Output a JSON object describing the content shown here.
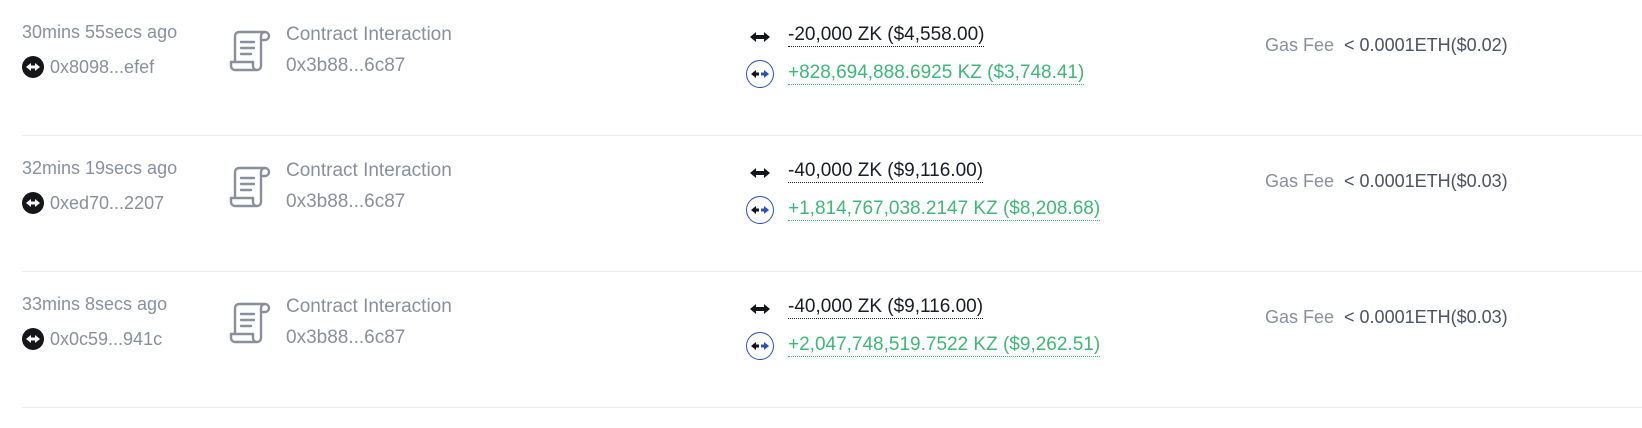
{
  "transactions": [
    {
      "time": "30mins 55secs ago",
      "sender": "0x8098...efef",
      "action": "Contract Interaction",
      "contract": "0x3b88...6c87",
      "amount_out": "-20,000 ZK ($4,558.00)",
      "amount_in": "+828,694,888.6925 KZ ($3,748.41)",
      "gas_label": "Gas Fee",
      "gas_value": "< 0.0001ETH($0.02)"
    },
    {
      "time": "32mins 19secs ago",
      "sender": "0xed70...2207",
      "action": "Contract Interaction",
      "contract": "0x3b88...6c87",
      "amount_out": "-40,000 ZK ($9,116.00)",
      "amount_in": "+1,814,767,038.2147 KZ ($8,208.68)",
      "gas_label": "Gas Fee",
      "gas_value": "< 0.0001ETH($0.03)"
    },
    {
      "time": "33mins 8secs ago",
      "sender": "0x0c59...941c",
      "action": "Contract Interaction",
      "contract": "0x3b88...6c87",
      "amount_out": "-40,000 ZK ($9,116.00)",
      "amount_in": "+2,047,748,519.7522 KZ ($9,262.51)",
      "gas_label": "Gas Fee",
      "gas_value": "< 0.0001ETH($0.03)"
    }
  ],
  "colors": {
    "muted_text": "#8a8f9c",
    "outgoing_amount": "#1b1d26",
    "incoming_amount": "#3cb878",
    "incoming_token_ring": "#2b4cc7",
    "divider": "#ebedf0"
  },
  "icons": {
    "chain": "zksync-chain-icon",
    "action": "contract-scroll-icon",
    "outgoing": "zk-token-icon",
    "incoming": "kz-token-icon"
  }
}
